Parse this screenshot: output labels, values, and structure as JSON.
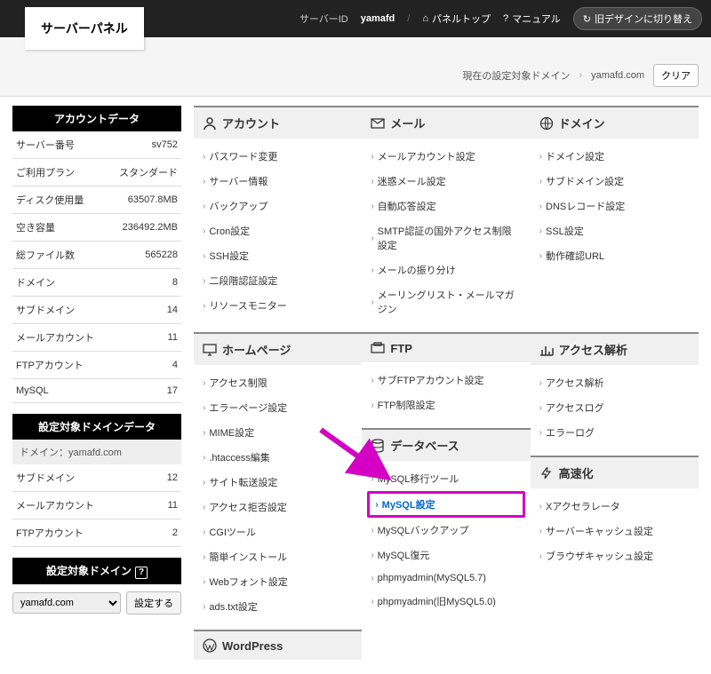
{
  "topbar": {
    "logo": "サーバーパネル",
    "server_id_label": "サーバーID",
    "server_id": "yamafd",
    "panel_top": "パネルトップ",
    "manual": "マニュアル",
    "switch_design": "旧デザインに切り替え"
  },
  "subbar": {
    "label": "現在の設定対象ドメイン",
    "domain": "yamafd.com",
    "clear": "クリア"
  },
  "account_data": {
    "header": "アカウントデータ",
    "rows": [
      {
        "k": "サーバー番号",
        "v": "sv752"
      },
      {
        "k": "ご利用プラン",
        "v": "スタンダード"
      },
      {
        "k": "ディスク使用量",
        "v": "63507.8MB"
      },
      {
        "k": "空き容量",
        "v": "236492.2MB"
      },
      {
        "k": "総ファイル数",
        "v": "565228"
      },
      {
        "k": "ドメイン",
        "v": "8"
      },
      {
        "k": "サブドメイン",
        "v": "14"
      },
      {
        "k": "メールアカウント",
        "v": "11"
      },
      {
        "k": "FTPアカウント",
        "v": "4"
      },
      {
        "k": "MySQL",
        "v": "17"
      }
    ]
  },
  "domain_data": {
    "header": "設定対象ドメインデータ",
    "domain_label": "ドメイン：",
    "domain": "yamafd.com",
    "rows": [
      {
        "k": "サブドメイン",
        "v": "12"
      },
      {
        "k": "メールアカウント",
        "v": "11"
      },
      {
        "k": "FTPアカウント",
        "v": "2"
      }
    ]
  },
  "domain_select": {
    "header": "設定対象ドメイン",
    "selected": "yamafd.com",
    "button": "設定する"
  },
  "sections": {
    "account": {
      "title": "アカウント",
      "items": [
        "パスワード変更",
        "サーバー情報",
        "バックアップ",
        "Cron設定",
        "SSH設定",
        "二段階認証設定",
        "リソースモニター"
      ]
    },
    "mail": {
      "title": "メール",
      "items": [
        "メールアカウント設定",
        "迷惑メール設定",
        "自動応答設定",
        "SMTP認証の国外アクセス制限設定",
        "メールの振り分け",
        "メーリングリスト・メールマガジン"
      ]
    },
    "domain": {
      "title": "ドメイン",
      "items": [
        "ドメイン設定",
        "サブドメイン設定",
        "DNSレコード設定",
        "SSL設定",
        "動作確認URL"
      ]
    },
    "homepage": {
      "title": "ホームページ",
      "items": [
        "アクセス制限",
        "エラーページ設定",
        "MIME設定",
        ".htaccess編集",
        "サイト転送設定",
        "アクセス拒否設定",
        "CGIツール",
        "簡単インストール",
        "Webフォント設定",
        "ads.txt設定"
      ]
    },
    "ftp": {
      "title": "FTP",
      "items": [
        "サブFTPアカウント設定",
        "FTP制限設定"
      ]
    },
    "analytics": {
      "title": "アクセス解析",
      "items": [
        "アクセス解析",
        "アクセスログ",
        "エラーログ"
      ]
    },
    "database": {
      "title": "データベース",
      "items": [
        "MySQL移行ツール",
        "MySQL設定",
        "MySQLバックアップ",
        "MySQL復元",
        "phpmyadmin(MySQL5.7)",
        "phpmyadmin(旧MySQL5.0)"
      ]
    },
    "speed": {
      "title": "高速化",
      "items": [
        "Xアクセラレータ",
        "サーバーキャッシュ設定",
        "ブラウザキャッシュ設定"
      ]
    },
    "wordpress": {
      "title": "WordPress"
    }
  }
}
